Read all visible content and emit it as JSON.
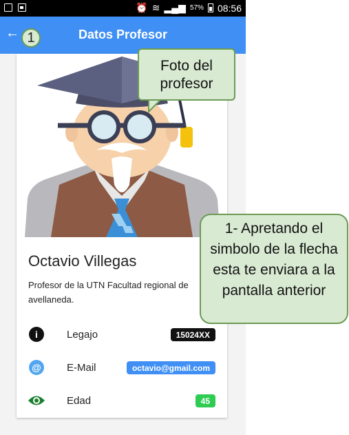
{
  "status_bar": {
    "battery_percent": "57%",
    "time": "08:56"
  },
  "app_bar": {
    "back_glyph": "←",
    "title": "Datos Profesor"
  },
  "step_badge": "1",
  "callouts": {
    "photo": "Foto del profesor",
    "back_arrow": "1- Apretando el simbolo de la flecha esta te enviara a la pantalla anterior"
  },
  "profile": {
    "name": "Octavio Villegas",
    "description": "Profesor de la UTN Facultad regional de avellaneda.",
    "rows": [
      {
        "icon": "info-icon",
        "label": "Legajo",
        "value": "15024XX",
        "color": "#111111"
      },
      {
        "icon": "at-icon",
        "label": "E-Mail",
        "value": "octavio@gmail.com",
        "color": "#3f8ff4"
      },
      {
        "icon": "eye-icon",
        "label": "Edad",
        "value": "45",
        "color": "#2ecc52"
      }
    ]
  },
  "colors": {
    "app_bar": "#3f8ff4",
    "callout_fill": "#d9ead3",
    "callout_border": "#6a9a54"
  }
}
